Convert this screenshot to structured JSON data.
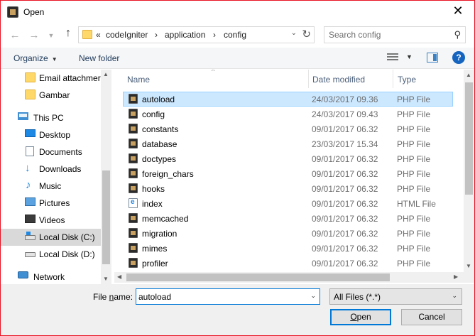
{
  "window": {
    "title": "Open",
    "close_glyph": "✕"
  },
  "nav": {
    "back_glyph": "←",
    "forward_glyph": "→",
    "up_glyph": "↑"
  },
  "address": {
    "overflow": "«",
    "crumbs": [
      "codeIgniter",
      "application",
      "config"
    ],
    "separator": "›",
    "dropdown_glyph": "⌄",
    "refresh_glyph": "↻"
  },
  "search": {
    "placeholder": "Search config",
    "icon": "search-icon",
    "glyph": "⚲"
  },
  "toolbar": {
    "organize_label": "Organize",
    "caret": "▼",
    "new_folder_label": "New folder",
    "help_label": "?"
  },
  "sidebar": {
    "items": [
      {
        "label": "Email attachmer",
        "icon": "folder-icon"
      },
      {
        "label": "Gambar",
        "icon": "folder-icon"
      },
      {
        "label": "This PC",
        "icon": "computer-icon"
      },
      {
        "label": "Desktop",
        "icon": "desktop-icon"
      },
      {
        "label": "Documents",
        "icon": "documents-icon"
      },
      {
        "label": "Downloads",
        "icon": "download-icon"
      },
      {
        "label": "Music",
        "icon": "music-icon"
      },
      {
        "label": "Pictures",
        "icon": "pictures-icon"
      },
      {
        "label": "Videos",
        "icon": "videos-icon"
      },
      {
        "label": "Local Disk (C:)",
        "icon": "disk-icon"
      },
      {
        "label": "Local Disk (D:)",
        "icon": "disk-icon"
      },
      {
        "label": "Network",
        "icon": "network-icon"
      }
    ],
    "selected": "Local Disk (C:)"
  },
  "files": {
    "columns": {
      "name": "Name",
      "date": "Date modified",
      "type": "Type",
      "sort_glyph": "^"
    },
    "rows": [
      {
        "name": "autoload",
        "date": "24/03/2017 09.36",
        "type": "PHP File",
        "icon": "php-file-icon"
      },
      {
        "name": "config",
        "date": "24/03/2017 09.43",
        "type": "PHP File",
        "icon": "php-file-icon"
      },
      {
        "name": "constants",
        "date": "09/01/2017 06.32",
        "type": "PHP File",
        "icon": "php-file-icon"
      },
      {
        "name": "database",
        "date": "23/03/2017 15.34",
        "type": "PHP File",
        "icon": "php-file-icon"
      },
      {
        "name": "doctypes",
        "date": "09/01/2017 06.32",
        "type": "PHP File",
        "icon": "php-file-icon"
      },
      {
        "name": "foreign_chars",
        "date": "09/01/2017 06.32",
        "type": "PHP File",
        "icon": "php-file-icon"
      },
      {
        "name": "hooks",
        "date": "09/01/2017 06.32",
        "type": "PHP File",
        "icon": "php-file-icon"
      },
      {
        "name": "index",
        "date": "09/01/2017 06.32",
        "type": "HTML File",
        "icon": "html-file-icon"
      },
      {
        "name": "memcached",
        "date": "09/01/2017 06.32",
        "type": "PHP File",
        "icon": "php-file-icon"
      },
      {
        "name": "migration",
        "date": "09/01/2017 06.32",
        "type": "PHP File",
        "icon": "php-file-icon"
      },
      {
        "name": "mimes",
        "date": "09/01/2017 06.32",
        "type": "PHP File",
        "icon": "php-file-icon"
      },
      {
        "name": "profiler",
        "date": "09/01/2017 06.32",
        "type": "PHP File",
        "icon": "php-file-icon"
      }
    ],
    "selected": "autoload"
  },
  "scroll": {
    "up": "▲",
    "down": "▼",
    "left": "◀",
    "right": "▶"
  },
  "footer": {
    "file_name_label_pre": "File ",
    "file_name_label_u": "n",
    "file_name_label_post": "ame:",
    "file_name_value": "autoload",
    "file_type": "All Files (*.*)",
    "dropdown_glyph": "⌄",
    "open_pre": "",
    "open_u": "O",
    "open_post": "pen",
    "cancel_label": "Cancel"
  }
}
